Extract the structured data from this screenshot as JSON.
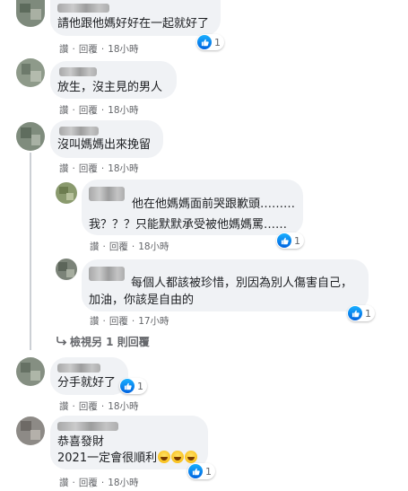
{
  "comments": [
    {
      "id": "c1",
      "text": "請他跟他媽好好在一起就好了",
      "actions": {
        "like": "讚",
        "reply": "回覆",
        "time": "18小時"
      },
      "reaction_count": "1"
    },
    {
      "id": "c2",
      "text": "放生，沒主見的男人",
      "actions": {
        "like": "讚",
        "reply": "回覆",
        "time": "18小時"
      }
    },
    {
      "id": "c3",
      "text": "沒叫媽媽出來挽留",
      "actions": {
        "like": "讚",
        "reply": "回覆",
        "time": "18小時"
      }
    },
    {
      "id": "r1",
      "text_line1": "他在他媽媽面前哭跟歉頭………",
      "text_line2": "我？？？只能默默承受被他媽媽罵……",
      "actions": {
        "like": "讚",
        "reply": "回覆",
        "time": "18小時"
      },
      "reaction_count": "1"
    },
    {
      "id": "r2",
      "text_line1": "每個人都該被珍惜，別因為別人傷害自己，",
      "text_line2": "加油，你該是自由的",
      "actions": {
        "like": "讚",
        "reply": "回覆",
        "time": "17小時"
      },
      "reaction_count": "1"
    },
    {
      "id": "c4",
      "text": "分手就好了",
      "actions": {
        "like": "讚",
        "reply": "回覆",
        "time": "18小時"
      },
      "reaction_count": "1"
    },
    {
      "id": "c5",
      "text_line1": "恭喜發財",
      "text_line2": "2021一定會很順利",
      "actions": {
        "like": "讚",
        "reply": "回覆",
        "time": "18小時"
      },
      "reaction_count": "1"
    }
  ],
  "more_replies_label": "檢視另 1 則回覆",
  "colors": {
    "bubble": "#f0f2f5",
    "meta": "#65676b",
    "like_blue": "#1877f2"
  },
  "icons": {
    "like": "thumbs-up-icon",
    "reply_arrow": "reply-arrow-icon",
    "emoji": "grinning-emoji-icon"
  }
}
